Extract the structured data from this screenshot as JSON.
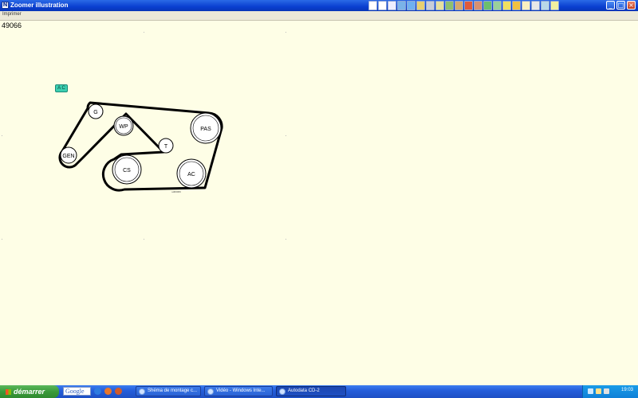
{
  "window": {
    "title": "Zoomer illustration",
    "toolbar_icons": [
      "first-page-icon",
      "prev-icon",
      "warning-icon",
      "chart-icon",
      "globe-icon",
      "tools-icon",
      "engine-icon",
      "table-icon",
      "wiring-icon",
      "image-icon",
      "globe2-icon",
      "car-icon",
      "display-icon",
      "book-icon",
      "note-icon",
      "gauge-icon",
      "bulb-icon",
      "person-icon",
      "key-icon",
      "info-icon"
    ],
    "controls": {
      "minimize": "_",
      "maximize": "□",
      "close": "×"
    }
  },
  "menu": {
    "print_label": "Imprimer"
  },
  "illustration": {
    "id": "49066",
    "ac_badge": "A C",
    "small_caption": "sd00066",
    "pulleys": [
      {
        "label": "G"
      },
      {
        "label": "WP"
      },
      {
        "label": "GEN"
      },
      {
        "label": "T"
      },
      {
        "label": "CS"
      },
      {
        "label": "AC"
      },
      {
        "label": "PAS"
      }
    ]
  },
  "taskbar": {
    "start_label": "démarrer",
    "search_label": "Google",
    "tasks": [
      {
        "label": "Shéma de montage c..."
      },
      {
        "label": "Vidéo - Windows Inte..."
      },
      {
        "label": "Autodata CD-2"
      }
    ],
    "language": "FR",
    "clock": "19:03"
  },
  "colors": {
    "canvas": "#fefee6",
    "titlebar": "#0a3fd0",
    "taskbar": "#245edb",
    "start": "#3a9a3a",
    "ac_badge": "#3ccfb0"
  }
}
